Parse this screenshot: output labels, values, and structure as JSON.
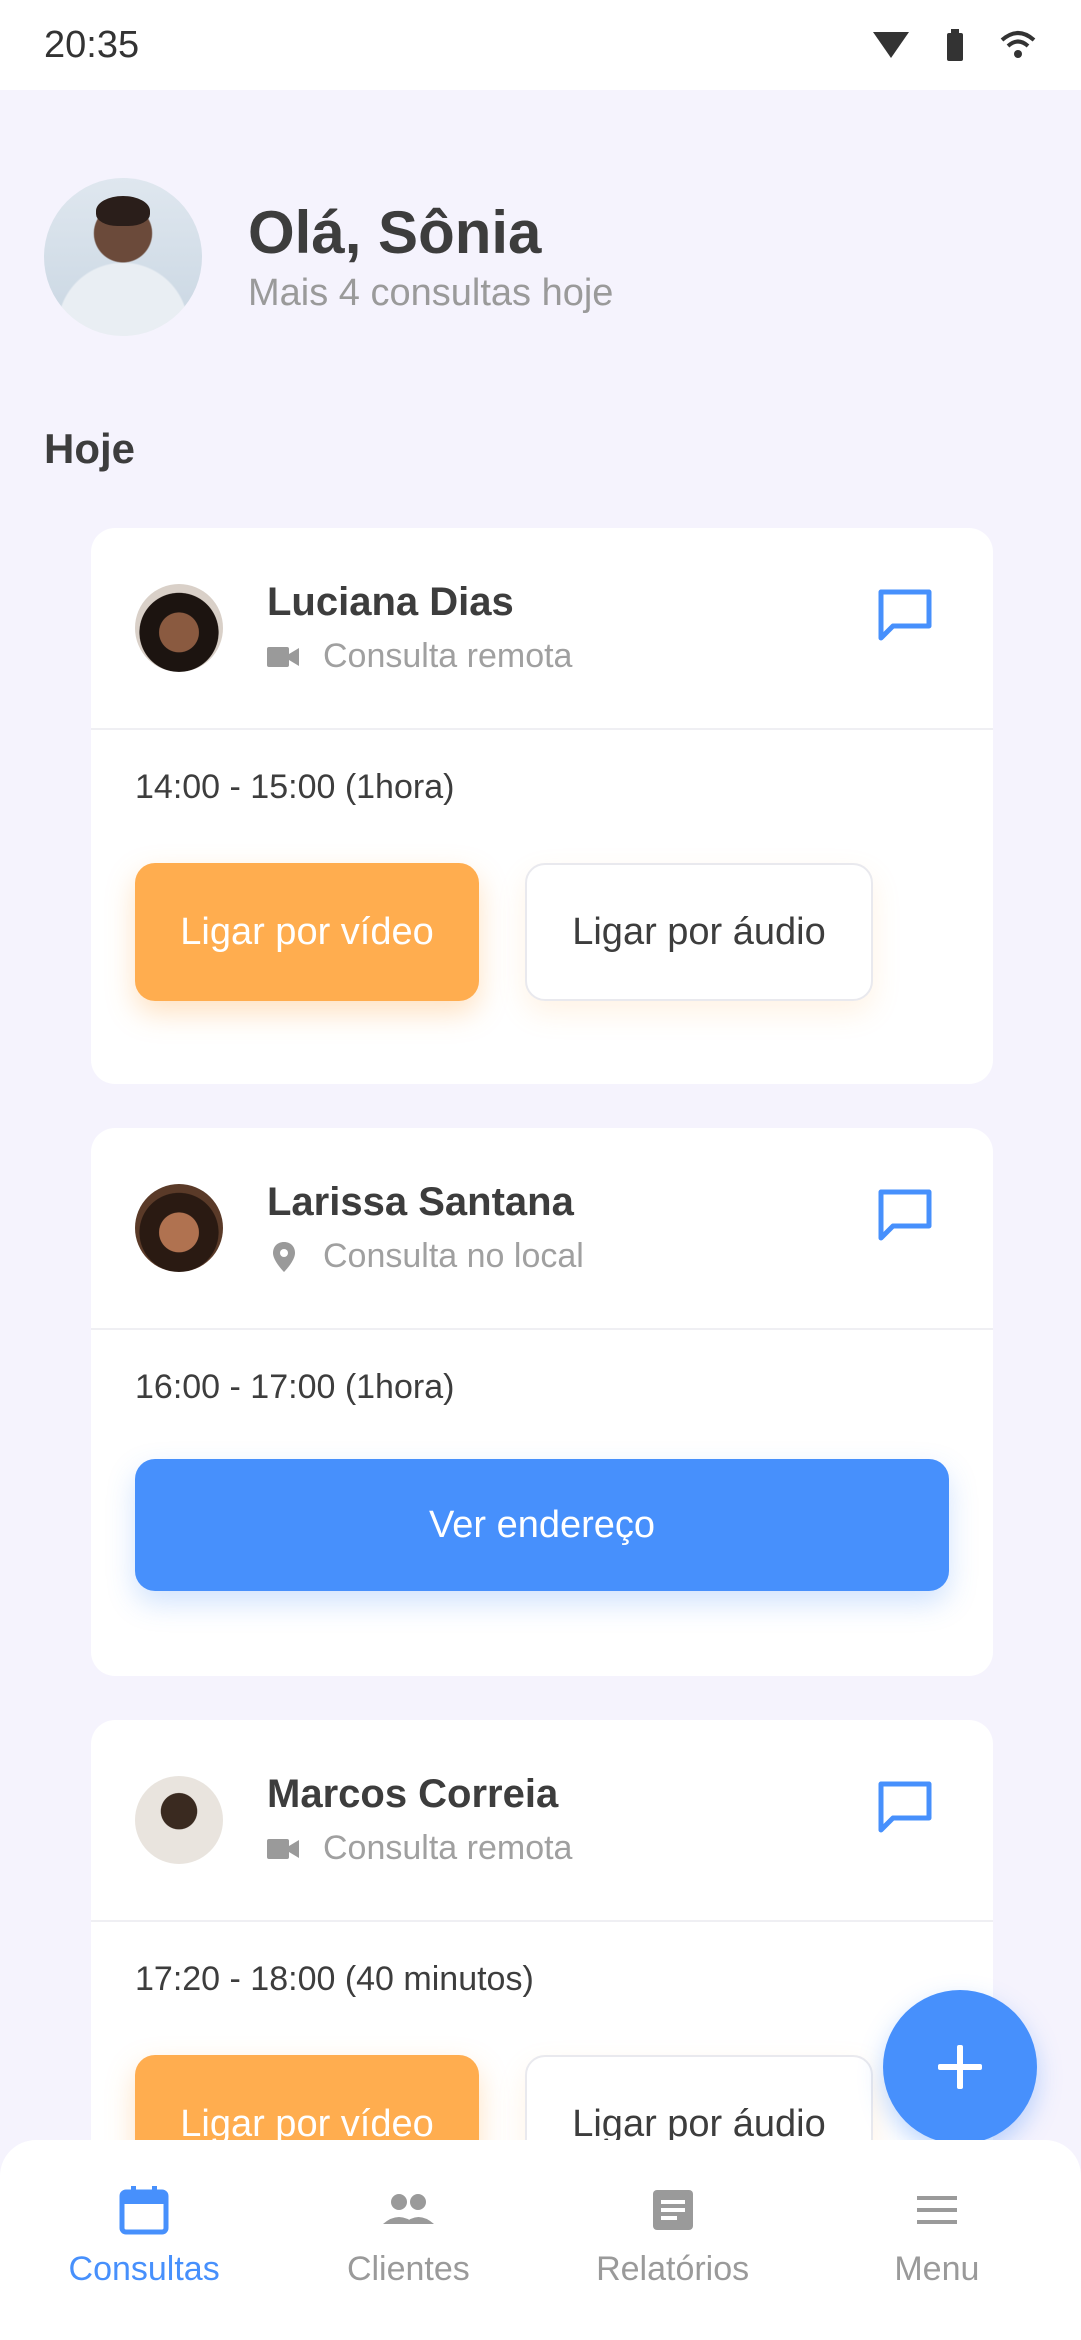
{
  "status_bar": {
    "time": "20:35"
  },
  "header": {
    "greeting": "Olá, Sônia",
    "subtitle": "Mais 4 consultas hoje"
  },
  "section": {
    "title": "Hoje"
  },
  "appointments": [
    {
      "name": "Luciana Dias",
      "type": "Consulta remota",
      "type_icon": "videocam-icon",
      "time": "14:00 - 15:00 (1hora)",
      "video_label": "Ligar por vídeo",
      "audio_label": "Ligar por áudio"
    },
    {
      "name": "Larissa Santana",
      "type": "Consulta no local",
      "type_icon": "location-pin-icon",
      "time": "16:00 - 17:00 (1hora)",
      "address_label": "Ver endereço"
    },
    {
      "name": "Marcos Correia",
      "type": "Consulta remota",
      "type_icon": "videocam-icon",
      "time": "17:20 - 18:00 (40 minutos)",
      "video_label": "Ligar por vídeo",
      "audio_label": "Ligar por áudio"
    }
  ],
  "nav": [
    {
      "label": "Consultas",
      "icon": "calendar-icon",
      "active": true
    },
    {
      "label": "Clientes",
      "icon": "people-icon",
      "active": false
    },
    {
      "label": "Relatórios",
      "icon": "report-icon",
      "active": false
    },
    {
      "label": "Menu",
      "icon": "menu-icon",
      "active": false
    }
  ],
  "colors": {
    "accent": "#4790FC",
    "orange": "#FFAD4F",
    "background": "#F5F3FD"
  }
}
